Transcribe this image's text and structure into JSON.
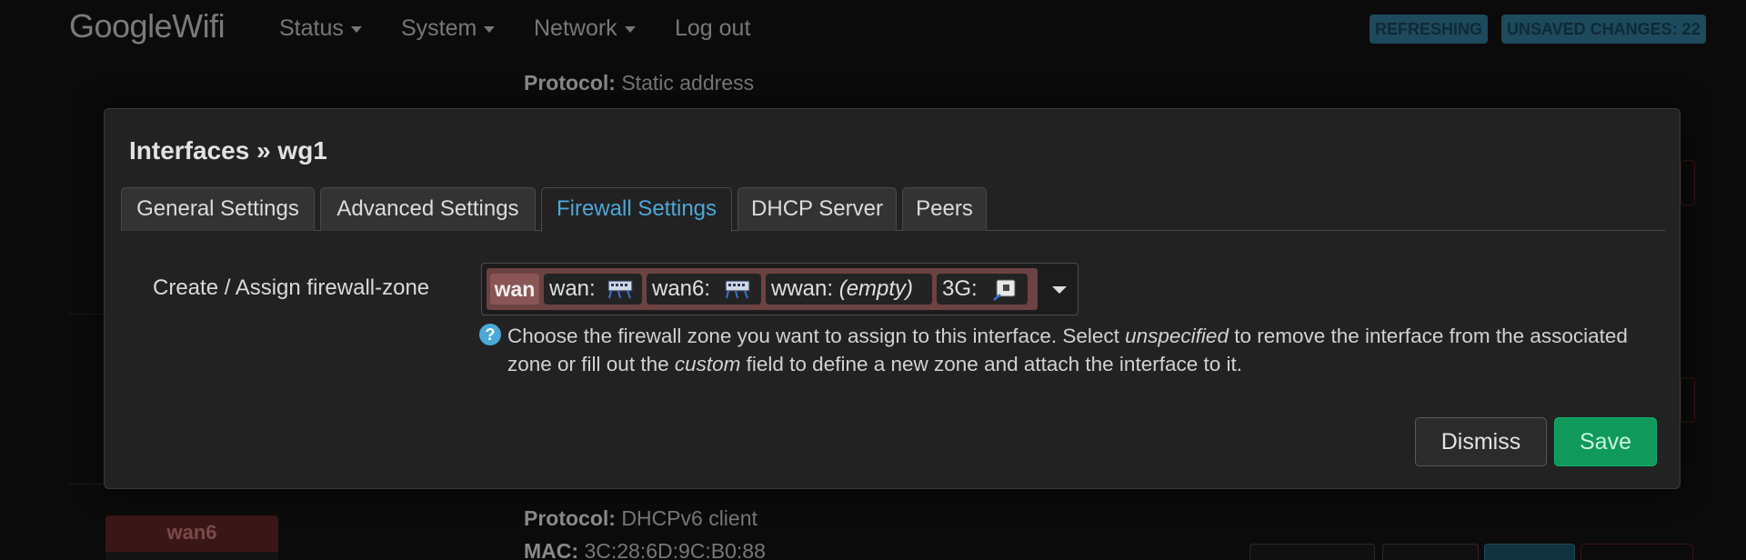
{
  "navbar": {
    "brand": "GoogleWifi",
    "menu": [
      {
        "label": "Status"
      },
      {
        "label": "System"
      },
      {
        "label": "Network"
      },
      {
        "label": "Log out"
      }
    ],
    "badges": [
      {
        "label": "REFRESHING"
      },
      {
        "label": "UNSAVED CHANGES: 22"
      }
    ]
  },
  "background": {
    "top_protocol_label": "Protocol:",
    "top_protocol_value": "Static address",
    "wan6_label": "wan6",
    "bottom_protocol_label": "Protocol:",
    "bottom_protocol_value": "DHCPv6 client",
    "bottom_mac_label": "MAC:",
    "bottom_mac_value": "3C:28:6D:9C:B0:88"
  },
  "modal": {
    "title": "Interfaces » wg1",
    "tabs": [
      {
        "label": "General Settings"
      },
      {
        "label": "Advanced Settings"
      },
      {
        "label": "Firewall Settings",
        "active": true
      },
      {
        "label": "DHCP Server"
      },
      {
        "label": "Peers"
      }
    ],
    "field_label": "Create / Assign firewall-zone",
    "zone": {
      "selected": "wan",
      "chips": [
        {
          "label": "wan:",
          "icon": "ethernet-icon"
        },
        {
          "label": "wan6:",
          "icon": "ethernet-icon"
        },
        {
          "label": "wwan:",
          "note": "(empty)"
        },
        {
          "label": "3G:",
          "icon": "modem-icon"
        }
      ]
    },
    "help": {
      "part1": "Choose the firewall zone you want to assign to this interface. Select ",
      "em1": "unspecified",
      "part2": " to remove the interface from the associated zone or fill out the ",
      "em2": "custom",
      "part3": " field to define a new zone and attach the interface to it."
    },
    "buttons": {
      "dismiss": "Dismiss",
      "save": "Save"
    }
  },
  "colors": {
    "accent": "#4aa9d8",
    "save": "#0f9a5c",
    "zone_wan": "#8a5555"
  }
}
